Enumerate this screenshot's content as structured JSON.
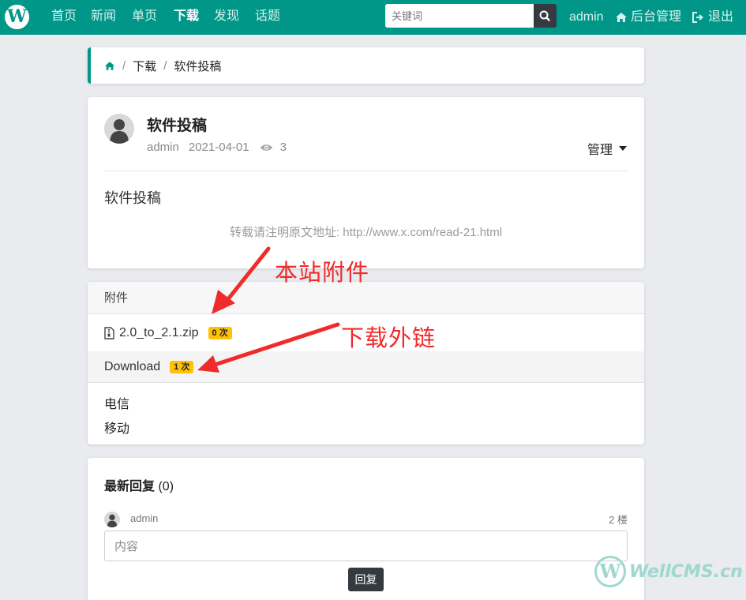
{
  "nav": {
    "logo_letter": "W",
    "items": [
      "首页",
      "新闻",
      "单页",
      "下载",
      "发现",
      "话题"
    ],
    "active_index": 3,
    "search_placeholder": "关键词",
    "user": "admin",
    "admin_label": "后台管理",
    "logout_label": "退出"
  },
  "breadcrumb": {
    "items": [
      "下载",
      "软件投稿"
    ]
  },
  "post": {
    "title": "软件投稿",
    "author": "admin",
    "date": "2021-04-01",
    "views": "3",
    "manage_label": "管理",
    "body": "软件投稿",
    "repost_notice": "转载请注明原文地址: http://www.x.com/read-21.html"
  },
  "attachments": {
    "header": "附件",
    "file": {
      "name": "2.0_to_2.1.zip",
      "count": "0 次"
    },
    "download": {
      "label": "Download",
      "count": "1 次"
    },
    "links": [
      "电信",
      "移动"
    ]
  },
  "replies": {
    "title": "最新回复",
    "count": "(0)",
    "user": "admin",
    "floor": "2 楼",
    "placeholder": "内容",
    "button": "回复"
  },
  "annotations": {
    "attach_label": "本站附件",
    "external_label": "下载外链"
  },
  "watermark": {
    "letter": "W",
    "text": "WellCMS.cn"
  },
  "colors": {
    "primary": "#009688",
    "badge": "#ffc107",
    "annotation": "#f02b2b",
    "dark": "#343a40"
  }
}
